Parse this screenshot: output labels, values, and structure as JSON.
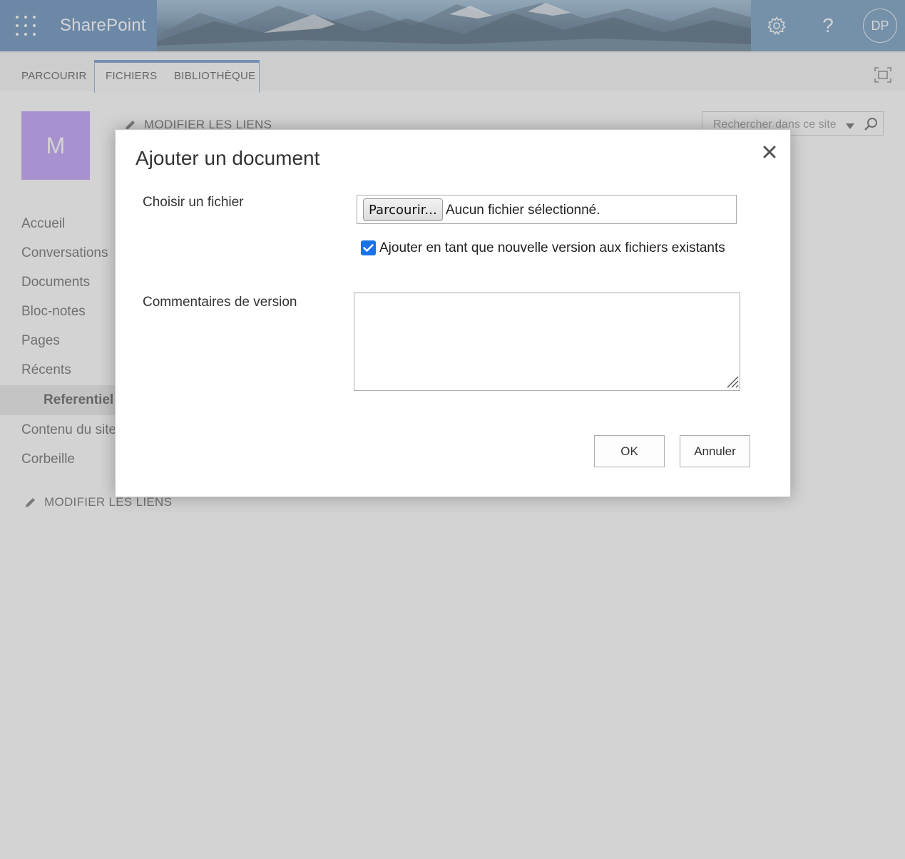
{
  "suitebar": {
    "brand": "SharePoint",
    "help_glyph": "?",
    "avatar_initials": "DP",
    "icons": [
      "waffle-icon",
      "gear-icon",
      "help-icon"
    ]
  },
  "ribbon": {
    "tabs": [
      "PARCOURIR",
      "FICHIERS",
      "BIBLIOTHÈQUE"
    ],
    "focus_icon": "focus-mode-icon"
  },
  "site": {
    "logo_letter": "M",
    "edit_links_label": "MODIFIER LES LIENS",
    "search_placeholder": "Rechercher dans ce site"
  },
  "quicklaunch": {
    "items": [
      "Accueil",
      "Conversations",
      "Documents",
      "Bloc-notes",
      "Pages",
      "Récents"
    ],
    "selected_sub": "Referentiel",
    "items_after": [
      "Contenu du site",
      "Corbeille"
    ],
    "edit_links_label": "MODIFIER LES LIENS"
  },
  "dialog": {
    "title": "Ajouter un document",
    "choose_file_label": "Choisir un fichier",
    "browse_button": "Parcourir...",
    "no_file_text": "Aucun fichier sélectionné.",
    "checkbox_checked": true,
    "checkbox_label": "Ajouter en tant que nouvelle version aux fichiers existants",
    "comments_label": "Commentaires de version",
    "comments_value": "",
    "ok_button": "OK",
    "cancel_button": "Annuler"
  },
  "colors": {
    "suitebar": "#4e7fb3",
    "logo_tile": "#b48ef8",
    "checkbox": "#1a73e8",
    "ribbon_active": "#5d8bc4"
  }
}
